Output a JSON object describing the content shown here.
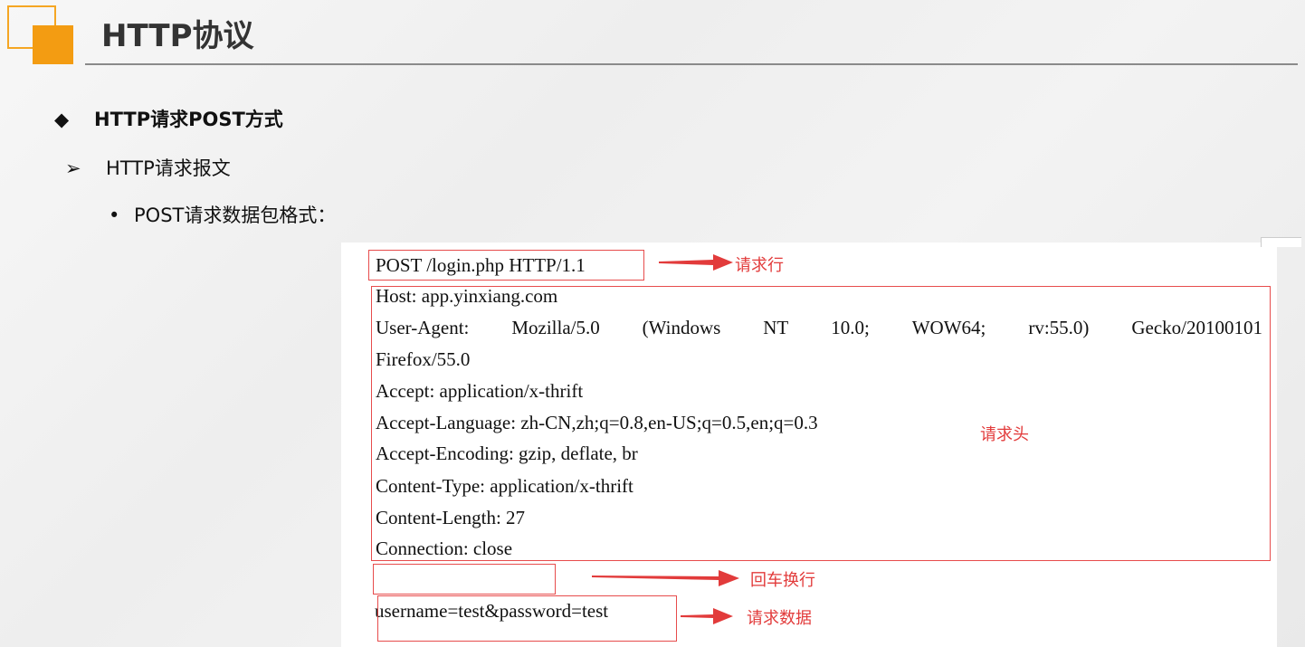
{
  "slide": {
    "title": "HTTP协议",
    "bullet1": {
      "marker": "◆",
      "text": "HTTP请求POST方式"
    },
    "bullet2": {
      "marker": "➢",
      "text": "HTTP请求报文"
    },
    "bullet3": {
      "marker": "•",
      "text": "POST请求数据包格式："
    }
  },
  "request": {
    "request_line": "POST /login.php HTTP/1.1",
    "headers": [
      "Host: app.yinxiang.com",
      "User-Agent:",
      "Mozilla/5.0",
      "(Windows",
      "NT",
      "10.0;",
      "WOW64;",
      "rv:55.0)",
      "Gecko/20100101",
      "Firefox/55.0",
      "Accept: application/x-thrift",
      "Accept-Language: zh-CN,zh;q=0.8,en-US;q=0.5,en;q=0.3",
      "Accept-Encoding: gzip, deflate, br",
      "Content-Type: application/x-thrift",
      "Content-Length: 27",
      "Connection: close"
    ],
    "body": "username=test&password=test"
  },
  "annotations": {
    "request_line": "请求行",
    "headers": "请求头",
    "blank_line": "回车换行",
    "body": "请求数据"
  },
  "colors": {
    "accent": "#f39c12",
    "annotation": "#e74c4c"
  }
}
